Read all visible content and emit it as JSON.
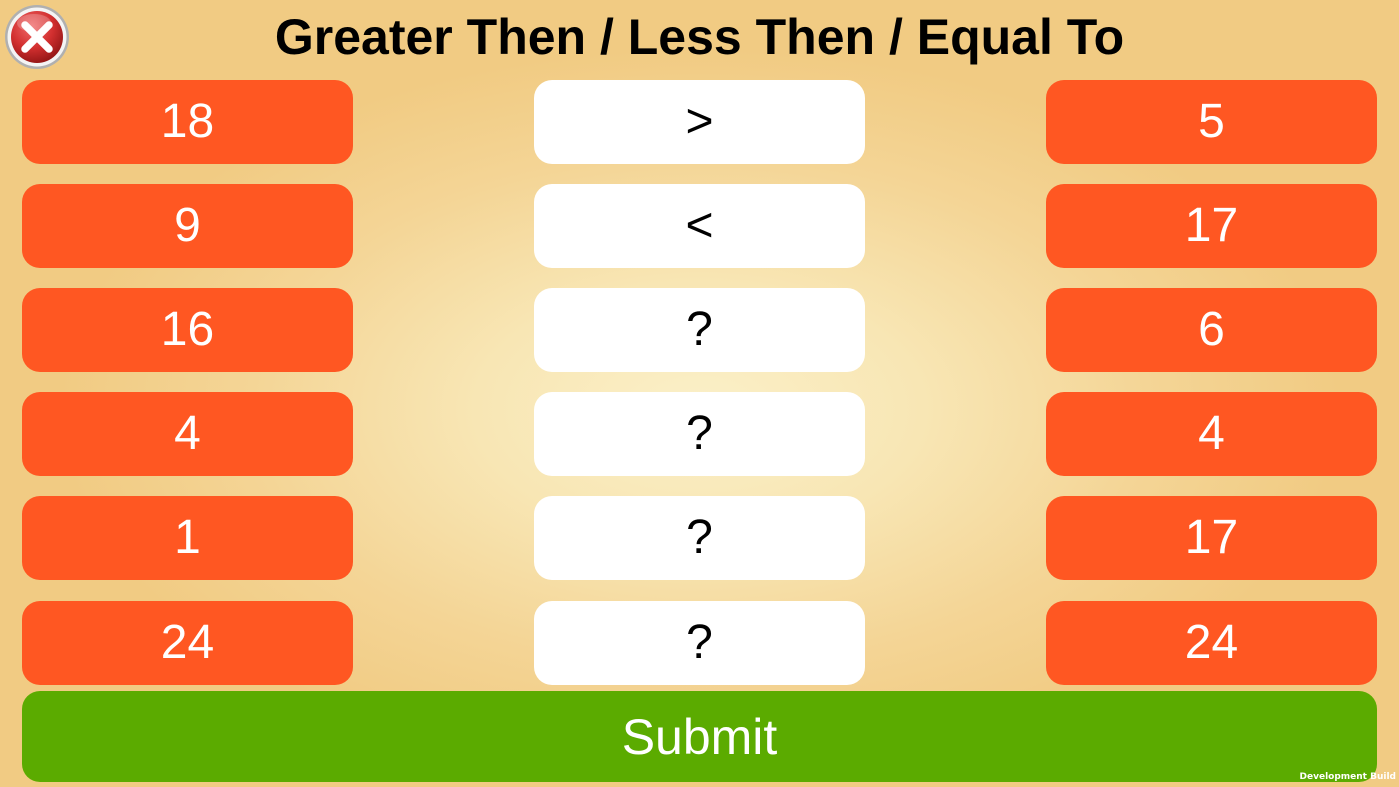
{
  "header": {
    "title": "Greater Then / Less Then / Equal To",
    "close_icon": "close-icon"
  },
  "rows": [
    {
      "left": "18",
      "operator": ">",
      "right": "5"
    },
    {
      "left": "9",
      "operator": "<",
      "right": "17"
    },
    {
      "left": "16",
      "operator": "?",
      "right": "6"
    },
    {
      "left": "4",
      "operator": "?",
      "right": "4"
    },
    {
      "left": "1",
      "operator": "?",
      "right": "17"
    },
    {
      "left": "24",
      "operator": "?",
      "right": "24"
    }
  ],
  "submit_label": "Submit",
  "footer": {
    "build_text": "Development Build"
  },
  "colors": {
    "number_tile": "#ff5722",
    "operator_tile": "#ffffff",
    "submit": "#5bab00",
    "close": "#d32f2f"
  }
}
